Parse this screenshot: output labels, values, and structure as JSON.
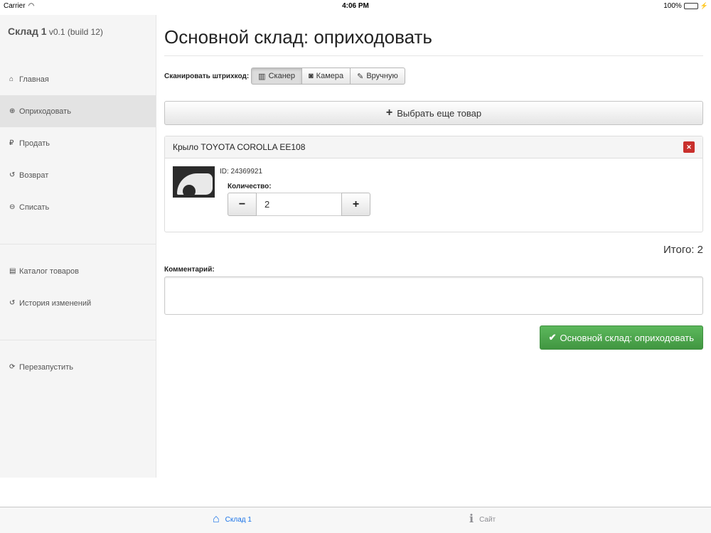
{
  "status": {
    "carrier": "Carrier",
    "time": "4:06 PM",
    "battery": "100%"
  },
  "sidebar": {
    "app_name": "Склад 1",
    "version": "v0.1 (build 12)",
    "items": [
      {
        "label": "Главная",
        "icon": "home-icon",
        "glyph": "⌂"
      },
      {
        "label": "Оприходовать",
        "icon": "plus-circle-icon",
        "glyph": "⊕"
      },
      {
        "label": "Продать",
        "icon": "ruble-icon",
        "glyph": "₽"
      },
      {
        "label": "Возврат",
        "icon": "undo-icon",
        "glyph": "↺"
      },
      {
        "label": "Списать",
        "icon": "minus-circle-icon",
        "glyph": "⊖"
      },
      {
        "label": "Каталог товаров",
        "icon": "archive-icon",
        "glyph": "▤"
      },
      {
        "label": "История изменений",
        "icon": "history-icon",
        "glyph": "↺"
      },
      {
        "label": "Перезапустить",
        "icon": "refresh-icon",
        "glyph": "⟳"
      }
    ]
  },
  "main": {
    "title": "Основной склад: оприходовать",
    "scan_label": "Сканировать штрихкод:",
    "scan_options": [
      {
        "label": "Сканер",
        "icon": "barcode-icon",
        "glyph": "▥"
      },
      {
        "label": "Камера",
        "icon": "camera-icon",
        "glyph": "◙"
      },
      {
        "label": "Вручную",
        "icon": "edit-icon",
        "glyph": "✎"
      }
    ],
    "add_item_label": "Выбрать еще товар",
    "product": {
      "title": "Крыло TOYOTA COROLLA EE108",
      "id_text": "ID: 24369921",
      "quantity_label": "Количество:",
      "quantity": "2"
    },
    "total": "Итого: 2",
    "comment_label": "Комментарий:",
    "comment_value": "",
    "submit_label": "Основной склад: оприходовать"
  },
  "tabbar": {
    "tabs": [
      {
        "label": "Склад 1",
        "icon": "home-icon",
        "glyph": "⌂"
      },
      {
        "label": "Сайт",
        "icon": "info-icon",
        "glyph": "ℹ"
      }
    ]
  },
  "colors": {
    "accent": "#1a73e8",
    "success": "#449d44",
    "danger": "#c9302c"
  }
}
